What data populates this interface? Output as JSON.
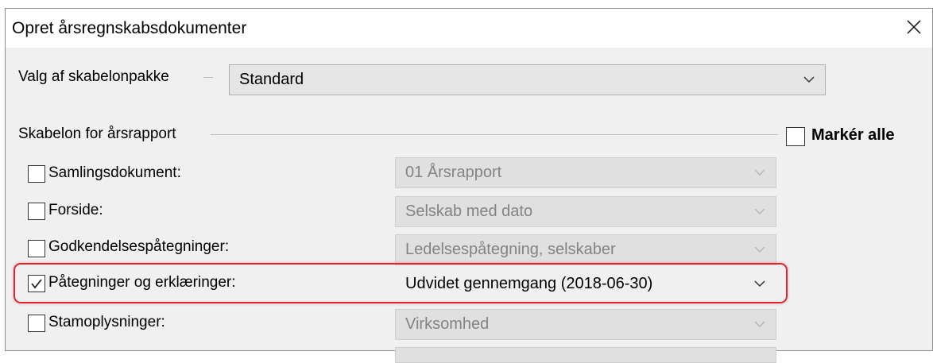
{
  "window": {
    "title": "Opret årsregnskabsdokumenter"
  },
  "template_package": {
    "label": "Valg af skabelonpakke",
    "value": "Standard"
  },
  "report_template": {
    "group_label": "Skabelon for årsrapport",
    "select_all_label": "Markér alle",
    "select_all_checked": false,
    "rows": [
      {
        "label": "Samlingsdokument:",
        "checked": false,
        "value": "01 Årsrapport",
        "enabled": false
      },
      {
        "label": "Forside:",
        "checked": false,
        "value": "Selskab med dato",
        "enabled": false
      },
      {
        "label": "Godkendelsespåtegninger:",
        "checked": false,
        "value": "Ledelsespåtegning, selskaber",
        "enabled": false
      },
      {
        "label": "Påtegninger og erklæringer:",
        "checked": true,
        "value": "Udvidet gennemgang (2018-06-30)",
        "enabled": true
      },
      {
        "label": "Stamoplysninger:",
        "checked": false,
        "value": "Virksomhed",
        "enabled": false
      }
    ]
  },
  "colors": {
    "highlight": "#e3232b",
    "disabled_text": "#838383"
  }
}
